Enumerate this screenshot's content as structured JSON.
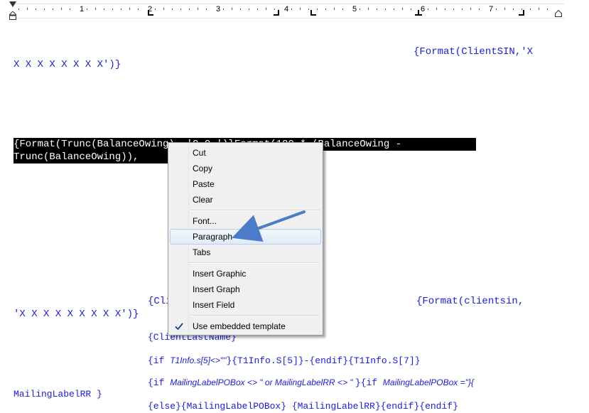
{
  "ruler": {
    "numbers": [
      "1",
      "2",
      "3",
      "4",
      "5",
      "6",
      "7"
    ]
  },
  "document": {
    "line1a": "{Format(ClientSIN,'X",
    "line1b": "X X X X X X X X')}",
    "sel_line1": "{Format(Trunc(BalanceOwing), '0.0.')}Format(100 * (BalanceOwing -",
    "sel_line2": "Trunc(BalanceOwing)),",
    "cli_fragment": "{Cli",
    "format2a": "{Format(clientsin,",
    "format2b": "'X X X X X X X X X')}",
    "lastname": "{ClientLastName}",
    "if_line": {
      "p1": "{if ",
      "p2": "T1Info.s[5]<>\"\"",
      "p3": "}{T1Info.S[5]}-{endif}{T1Info.S[7]}"
    },
    "if2_line": {
      "p1": "{if ",
      "p2": "MailingLabelPOBox <> \" or MailingLabelRR <> \" ",
      "p3": "}{if ",
      "p4": "MailingLabelPOBox =\"}{"
    },
    "mailing_rr": "MailingLabelRR }",
    "else_line": "{else}{MailingLabelPOBox} {MailingLabelRR}{endif}{endif}"
  },
  "context_menu": {
    "items": [
      {
        "label": "Cut"
      },
      {
        "label": "Copy"
      },
      {
        "label": "Paste"
      },
      {
        "label": "Clear"
      },
      {
        "label": "Font..."
      },
      {
        "label": "Paragraph",
        "highlighted": true
      },
      {
        "label": "Tabs"
      },
      {
        "label": "Insert Graphic"
      },
      {
        "label": "Insert Graph"
      },
      {
        "label": "Insert Field"
      },
      {
        "label": "Use embedded template",
        "checked": true
      }
    ]
  },
  "colors": {
    "field_text": "#1a1ae6",
    "selection_bg": "#000000",
    "menu_bg": "#f0f0f0",
    "arrow": "#4a7cc9"
  }
}
